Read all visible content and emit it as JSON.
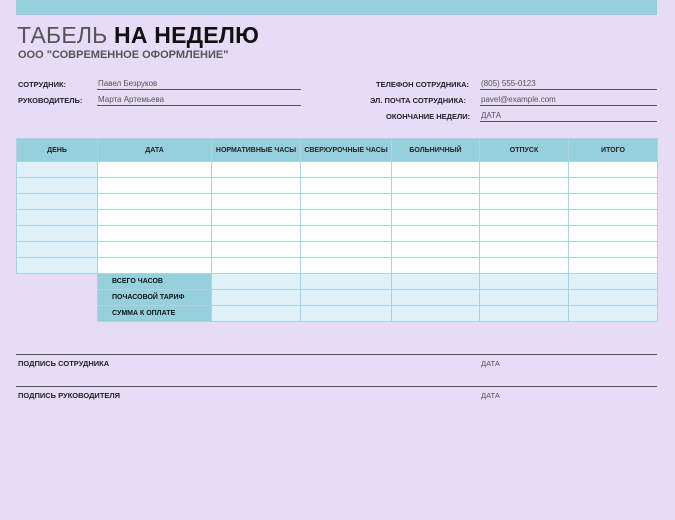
{
  "header": {
    "title_light": "ТАБЕЛЬ ",
    "title_bold": "НА НЕДЕЛЮ",
    "company": "ООО \"СОВРЕМЕННОЕ ОФОРМЛЕНИЕ\""
  },
  "info": {
    "employee_label": "СОТРУДНИК:",
    "employee_value": "Павел Безруков",
    "manager_label": "РУКОВОДИТЕЛЬ:",
    "manager_value": "Марта Артемьева",
    "phone_label": "ТЕЛЕФОН СОТРУДНИКА:",
    "phone_value": "(805) 555-0123",
    "email_label": "ЭЛ. ПОЧТА СОТРУДНИКА:",
    "email_value": "pavel@example.com",
    "week_end_label": "ОКОНЧАНИЕ НЕДЕЛИ:",
    "week_end_value": "ДАТА"
  },
  "table": {
    "headers": [
      "ДЕНЬ",
      "ДАТА",
      "НОРМАТИВНЫЕ ЧАСЫ",
      "СВЕРХУРОЧНЫЕ ЧАСЫ",
      "БОЛЬНИЧНЫЙ",
      "ОТПУСК",
      "ИТОГО"
    ],
    "summary_labels": [
      "ВСЕГО ЧАСОВ",
      "ПОЧАСОВОЙ ТАРИФ",
      "СУММА К ОПЛАТЕ"
    ]
  },
  "signatures": {
    "employee_label": "ПОДПИСЬ СОТРУДНИКА",
    "manager_label": "ПОДПИСЬ РУКОВОДИТЕЛЯ",
    "date_label": "ДАТА"
  }
}
